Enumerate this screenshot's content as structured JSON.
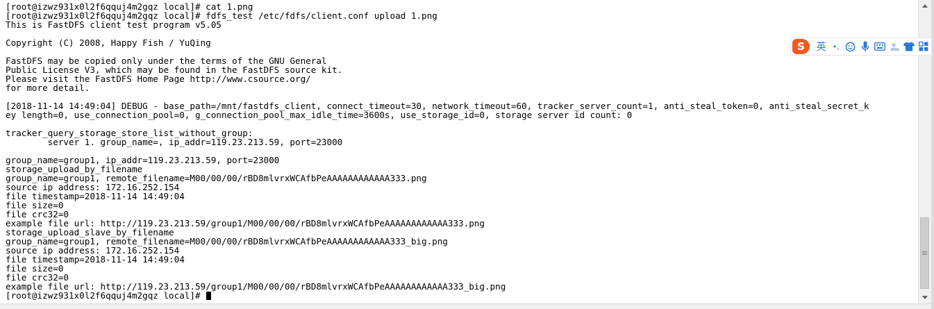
{
  "terminal": {
    "lines": [
      "[root@izwz931x0l2f6qquj4m2gqz local]# cat 1.png",
      "[root@izwz931x0l2f6qquj4m2gqz local]# fdfs_test /etc/fdfs/client.conf upload 1.png",
      "This is FastDFS client test program v5.05",
      "",
      "Copyright (C) 2008, Happy Fish / YuQing",
      "",
      "FastDFS may be copied only under the terms of the GNU General",
      "Public License V3, which may be found in the FastDFS source kit.",
      "Please visit the FastDFS Home Page http://www.csource.org/",
      "for more detail.",
      "",
      "[2018-11-14 14:49:04] DEBUG - base_path=/mnt/fastdfs_client, connect_timeout=30, network_timeout=60, tracker_server_count=1, anti_steal_token=0, anti_steal_secret_k",
      "ey length=0, use_connection_pool=0, g_connection_pool_max_idle_time=3600s, use_storage_id=0, storage server id count: 0",
      "",
      "tracker_query_storage_store_list_without_group:",
      "        server 1. group_name=, ip_addr=119.23.213.59, port=23000",
      "",
      "group_name=group1, ip_addr=119.23.213.59, port=23000",
      "storage_upload_by_filename",
      "group_name=group1, remote_filename=M00/00/00/rBD8mlvrxWCAfbPeAAAAAAAAAAAA333.png",
      "source ip address: 172.16.252.154",
      "file timestamp=2018-11-14 14:49:04",
      "file size=0",
      "file crc32=0",
      "example file url: http://119.23.213.59/group1/M00/00/00/rBD8mlvrxWCAfbPeAAAAAAAAAAAA333.png",
      "storage_upload_slave_by_filename",
      "group_name=group1, remote_filename=M00/00/00/rBD8mlvrxWCAfbPeAAAAAAAAAAAA333_big.png",
      "source ip address: 172.16.252.154",
      "file timestamp=2018-11-14 14:49:04",
      "file size=0",
      "file crc32=0",
      "example file url: http://119.23.213.59/group1/M00/00/00/rBD8mlvrxWCAfbPeAAAAAAAAAAAA333_big.png",
      "[root@izwz931x0l2f6qquj4m2gqz local]# "
    ]
  },
  "ime_toolbar": {
    "logo_text": "S",
    "mode_label": "英",
    "punct_label": "•,",
    "items": [
      {
        "icon": "emoji-icon"
      },
      {
        "icon": "microphone-icon"
      },
      {
        "icon": "keyboard-icon"
      },
      {
        "icon": "user-icon"
      },
      {
        "icon": "skin-shirt-icon"
      },
      {
        "icon": "grid-menu-icon"
      }
    ]
  },
  "scrollbar": {
    "position_fraction": 0.97
  }
}
